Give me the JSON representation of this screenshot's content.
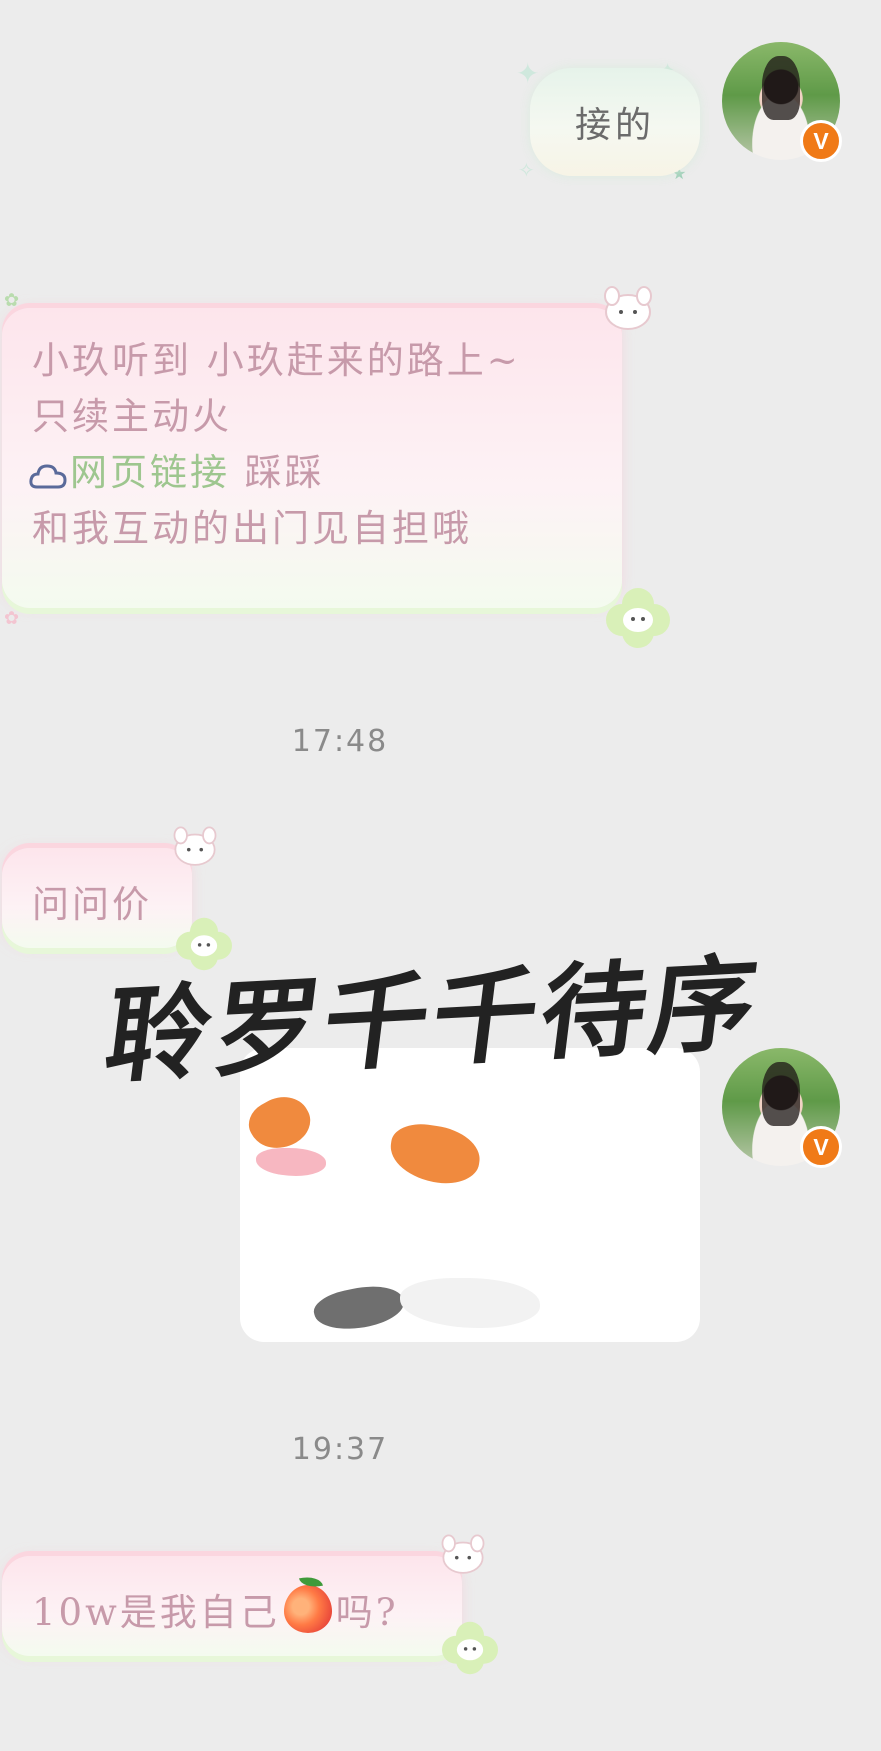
{
  "chat": {
    "messages": [
      {
        "sender": "me",
        "text": "接的"
      },
      {
        "sender": "them",
        "lines": [
          "小玖听到 小玖赶来的路上~",
          "只续主动火",
          "网页链接",
          "踩踩",
          "和我互动的出门见自担哦"
        ]
      },
      {
        "time": "17:48"
      },
      {
        "sender": "them",
        "text": "问问价"
      },
      {
        "sender": "me",
        "type": "image-card"
      },
      {
        "time": "19:37"
      },
      {
        "sender": "them",
        "text_before": "10w是我自己",
        "emoji": "peach-emoji",
        "text_after": "吗?"
      }
    ]
  },
  "watermark": {
    "text": "聆罗千千待序"
  },
  "colors": {
    "background": "#ececec",
    "their_bubble_text": "#c79aaa",
    "link_text": "#9ec68f",
    "my_bubble_text": "#6b6b6b",
    "verified_badge": "#f07a17",
    "timestamp": "#8a8a8a"
  },
  "icons": {
    "verified": "V",
    "cloud": "cloud-icon",
    "peach": "peach-emoji"
  }
}
